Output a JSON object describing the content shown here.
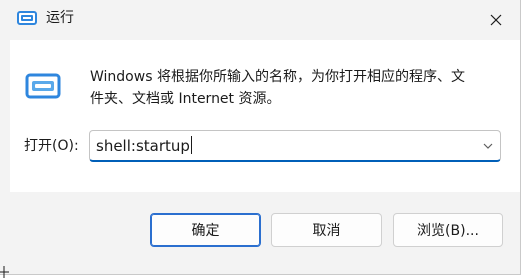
{
  "window": {
    "title": "运行"
  },
  "icons": {
    "title_icon": "run-icon",
    "big_icon": "run-icon",
    "close_icon": "close-icon",
    "dropdown_icon": "chevron-down-icon"
  },
  "content": {
    "description_line1": "Windows 将根据你所输入的名称，为你打开相应的程序、文",
    "description_line2": "件夹、文档或 Internet 资源。",
    "open_label": "打开(O):",
    "input_value": "shell:startup"
  },
  "buttons": {
    "ok_label": "确定",
    "cancel_label": "取消",
    "browse_label": "浏览(B)..."
  },
  "colors": {
    "accent": "#005fb8",
    "icon_blue": "#2e86de"
  }
}
